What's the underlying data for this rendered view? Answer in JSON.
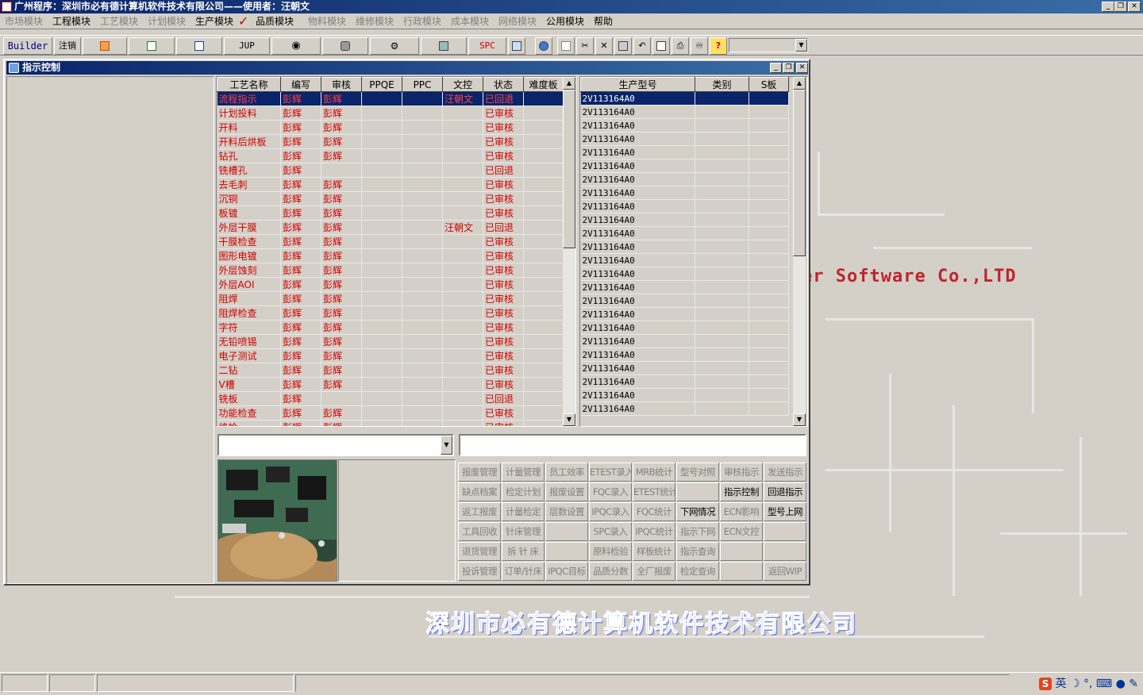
{
  "app": {
    "title": "广州程序：深圳市必有德计算机软件技术有限公司——使用者：汪朝文",
    "minimize": "_",
    "restore": "❐",
    "close": "✕"
  },
  "menu": [
    {
      "label": "市场模块",
      "enabled": false
    },
    {
      "label": "工程模块",
      "enabled": true
    },
    {
      "label": "工艺模块",
      "enabled": false
    },
    {
      "label": "计划模块",
      "enabled": false
    },
    {
      "label": "生产模块",
      "enabled": true
    },
    {
      "label": "品质模块",
      "enabled": true
    },
    {
      "label": "物料模块",
      "enabled": false
    },
    {
      "label": "维修模块",
      "enabled": false
    },
    {
      "label": "行政模块",
      "enabled": false
    },
    {
      "label": "成本模块",
      "enabled": false
    },
    {
      "label": "网络模块",
      "enabled": false
    },
    {
      "label": "公用模块",
      "enabled": true
    },
    {
      "label": "帮助",
      "enabled": true
    }
  ],
  "toolbar": {
    "builder": "Builder",
    "logout": "注销",
    "jup": "JUP",
    "spc": "SPC",
    "help_glyph": "?"
  },
  "background": {
    "software_text": "er Software Co.,LTD",
    "company_text": "深圳市必有德计算机软件技术有限公司"
  },
  "window": {
    "title": "指示控制"
  },
  "process_grid": {
    "headers": [
      "工艺名称",
      "编写",
      "审核",
      "PPQE",
      "PPC",
      "文控",
      "状态",
      "难度板"
    ],
    "rows": [
      [
        "流程指示",
        "彭辉",
        "彭辉",
        "",
        "",
        "汪朝文",
        "已回退",
        ""
      ],
      [
        "计划投料",
        "彭辉",
        "彭辉",
        "",
        "",
        "",
        "已审核",
        ""
      ],
      [
        "开料",
        "彭辉",
        "彭辉",
        "",
        "",
        "",
        "已审核",
        ""
      ],
      [
        "开料后烘板",
        "彭辉",
        "彭辉",
        "",
        "",
        "",
        "已审核",
        ""
      ],
      [
        "钻孔",
        "彭辉",
        "彭辉",
        "",
        "",
        "",
        "已审核",
        ""
      ],
      [
        "铣槽孔",
        "彭辉",
        "",
        "",
        "",
        "",
        "已回退",
        ""
      ],
      [
        "去毛刺",
        "彭辉",
        "彭辉",
        "",
        "",
        "",
        "已审核",
        ""
      ],
      [
        "沉铜",
        "彭辉",
        "彭辉",
        "",
        "",
        "",
        "已审核",
        ""
      ],
      [
        "板镀",
        "彭辉",
        "彭辉",
        "",
        "",
        "",
        "已审核",
        ""
      ],
      [
        "外层干膜",
        "彭辉",
        "彭辉",
        "",
        "",
        "汪朝文",
        "已回退",
        ""
      ],
      [
        "干膜检查",
        "彭辉",
        "彭辉",
        "",
        "",
        "",
        "已审核",
        ""
      ],
      [
        "图形电镀",
        "彭辉",
        "彭辉",
        "",
        "",
        "",
        "已审核",
        ""
      ],
      [
        "外层蚀刻",
        "彭辉",
        "彭辉",
        "",
        "",
        "",
        "已审核",
        ""
      ],
      [
        "外层AOI",
        "彭辉",
        "彭辉",
        "",
        "",
        "",
        "已审核",
        ""
      ],
      [
        "阻焊",
        "彭辉",
        "彭辉",
        "",
        "",
        "",
        "已审核",
        ""
      ],
      [
        "阻焊检查",
        "彭辉",
        "彭辉",
        "",
        "",
        "",
        "已审核",
        ""
      ],
      [
        "字符",
        "彭辉",
        "彭辉",
        "",
        "",
        "",
        "已审核",
        ""
      ],
      [
        "无铅喷锡",
        "彭辉",
        "彭辉",
        "",
        "",
        "",
        "已审核",
        ""
      ],
      [
        "电子测试",
        "彭辉",
        "彭辉",
        "",
        "",
        "",
        "已审核",
        ""
      ],
      [
        "二钻",
        "彭辉",
        "彭辉",
        "",
        "",
        "",
        "已审核",
        ""
      ],
      [
        "V槽",
        "彭辉",
        "彭辉",
        "",
        "",
        "",
        "已审核",
        ""
      ],
      [
        "铣板",
        "彭辉",
        "",
        "",
        "",
        "",
        "已回退",
        ""
      ],
      [
        "功能检查",
        "彭辉",
        "彭辉",
        "",
        "",
        "",
        "已审核",
        ""
      ],
      [
        "终检",
        "彭辉",
        "彭辉",
        "",
        "",
        "",
        "已审核",
        ""
      ]
    ]
  },
  "model_grid": {
    "headers": [
      "生产型号",
      "类别",
      "S板"
    ],
    "rows": [
      [
        "2V113164A0",
        "",
        ""
      ],
      [
        "2V113164A0",
        "",
        ""
      ],
      [
        "2V113164A0",
        "",
        ""
      ],
      [
        "2V113164A0",
        "",
        ""
      ],
      [
        "2V113164A0",
        "",
        ""
      ],
      [
        "2V113164A0",
        "",
        ""
      ],
      [
        "2V113164A0",
        "",
        ""
      ],
      [
        "2V113164A0",
        "",
        ""
      ],
      [
        "2V113164A0",
        "",
        ""
      ],
      [
        "2V113164A0",
        "",
        ""
      ],
      [
        "2V113164A0",
        "",
        ""
      ],
      [
        "2V113164A0",
        "",
        ""
      ],
      [
        "2V113164A0",
        "",
        ""
      ],
      [
        "2V113164A0",
        "",
        ""
      ],
      [
        "2V113164A0",
        "",
        ""
      ],
      [
        "2V113164A0",
        "",
        ""
      ],
      [
        "2V113164A0",
        "",
        ""
      ],
      [
        "2V113164A0",
        "",
        ""
      ],
      [
        "2V113164A0",
        "",
        ""
      ],
      [
        "2V113164A0",
        "",
        ""
      ],
      [
        "2V113164A0",
        "",
        ""
      ],
      [
        "2V113164A0",
        "",
        ""
      ],
      [
        "2V113164A0",
        "",
        ""
      ],
      [
        "2V113164A0",
        "",
        ""
      ]
    ]
  },
  "inputs": {
    "left_combo_value": "",
    "right_text_value": ""
  },
  "function_buttons": [
    [
      {
        "label": "报废管理",
        "enabled": false
      },
      {
        "label": "计量管理",
        "enabled": false
      },
      {
        "label": "员工效率",
        "enabled": false
      },
      {
        "label": "ETEST录入",
        "enabled": false
      },
      {
        "label": "MRB统计",
        "enabled": false
      },
      {
        "label": "型号对照",
        "enabled": false
      },
      {
        "label": "审核指示",
        "enabled": false
      },
      {
        "label": "发送指示",
        "enabled": false
      }
    ],
    [
      {
        "label": "缺点档案",
        "enabled": false
      },
      {
        "label": "检定计划",
        "enabled": false
      },
      {
        "label": "报废设置",
        "enabled": false
      },
      {
        "label": "FQC录入",
        "enabled": false
      },
      {
        "label": "ETEST统计",
        "enabled": false
      },
      {
        "label": "",
        "enabled": false
      },
      {
        "label": "指示控制",
        "enabled": true
      },
      {
        "label": "回退指示",
        "enabled": true
      }
    ],
    [
      {
        "label": "返工报废",
        "enabled": false
      },
      {
        "label": "计量检定",
        "enabled": false
      },
      {
        "label": "层数设置",
        "enabled": false
      },
      {
        "label": "IPQC录入",
        "enabled": false
      },
      {
        "label": "FQC统计",
        "enabled": false
      },
      {
        "label": "下网情况",
        "enabled": true
      },
      {
        "label": "ECN影响",
        "enabled": false
      },
      {
        "label": "型号上网",
        "enabled": true
      }
    ],
    [
      {
        "label": "工具回收",
        "enabled": false
      },
      {
        "label": "针床管理",
        "enabled": false
      },
      {
        "label": "",
        "enabled": false
      },
      {
        "label": "SPC录入",
        "enabled": false
      },
      {
        "label": "IPQC统计",
        "enabled": false
      },
      {
        "label": "指示下网",
        "enabled": false
      },
      {
        "label": "ECN文控",
        "enabled": false
      },
      {
        "label": "",
        "enabled": false
      }
    ],
    [
      {
        "label": "退货管理",
        "enabled": false
      },
      {
        "label": "拆 针 床",
        "enabled": false
      },
      {
        "label": "",
        "enabled": false
      },
      {
        "label": "原料检验",
        "enabled": false
      },
      {
        "label": "样板统计",
        "enabled": false
      },
      {
        "label": "指示查询",
        "enabled": false
      },
      {
        "label": "",
        "enabled": false
      },
      {
        "label": "",
        "enabled": false
      }
    ],
    [
      {
        "label": "投诉管理",
        "enabled": false
      },
      {
        "label": "订单/针床",
        "enabled": false
      },
      {
        "label": "IPQC目标",
        "enabled": false
      },
      {
        "label": "品质分数",
        "enabled": false
      },
      {
        "label": "全厂报废",
        "enabled": false
      },
      {
        "label": "检定查询",
        "enabled": false
      },
      {
        "label": "",
        "enabled": false
      },
      {
        "label": "返回WIP",
        "enabled": false
      }
    ]
  ],
  "statusbar": {
    "ime_text": "英"
  },
  "colors": {
    "title_blue": "#0a246a",
    "grid_red": "#d00000",
    "brand_red": "#c0242c",
    "company_blue": "#4a5fd6"
  }
}
